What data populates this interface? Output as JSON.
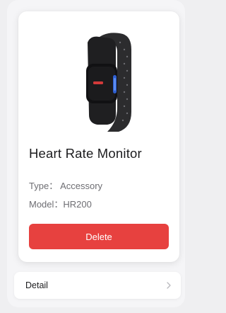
{
  "product": {
    "name": "Heart Rate Monitor",
    "type_line": "Type：  Accessory",
    "model_line": "Model：HR200",
    "image_icon": "heart-rate-armband"
  },
  "actions": {
    "delete_label": "Delete",
    "delete_color": "#e7413f"
  },
  "detail_row": {
    "label": "Detail",
    "chevron_icon": "chevron-right"
  }
}
